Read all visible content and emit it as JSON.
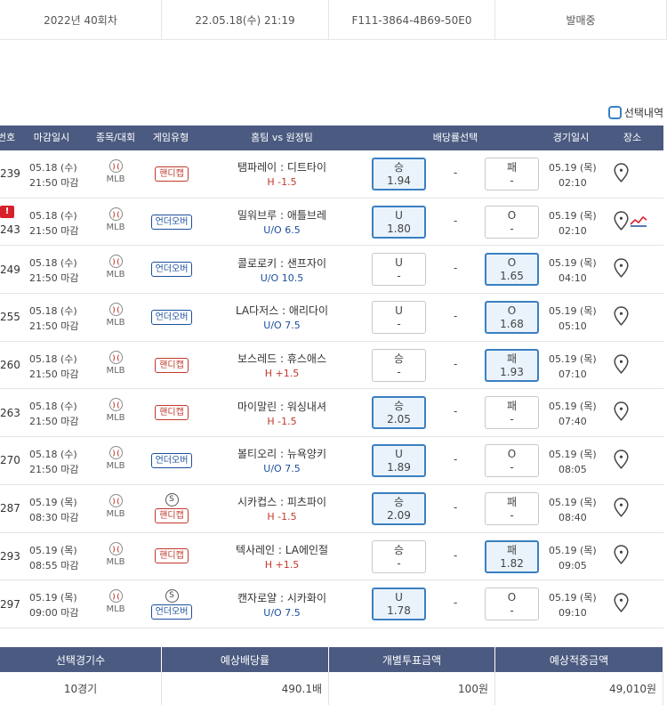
{
  "top": {
    "round": "2022년 40회차",
    "datetime": "22.05.18(수) 21:19",
    "code": "F111-3864-4B69-50E0",
    "status": "발매중"
  },
  "legend": {
    "label": "선택내역"
  },
  "headers": [
    "번호",
    "마감일시",
    "종목/대회",
    "게임유형",
    "홈팀 vs 원정팀",
    "배당률선택",
    "경기일시",
    "장소"
  ],
  "games": [
    {
      "no": "239",
      "alert": "",
      "close_date": "05.18 (수)",
      "close_time": "21:50 마감",
      "league": "MLB",
      "special": "",
      "type": "핸디캡",
      "type_kind": "handi",
      "match": "탬파레이 : 디트타이",
      "line": "H -1.5",
      "line_color": "red",
      "left_label": "승",
      "left_odds": "1.94",
      "left_selected": true,
      "mid": "-",
      "right_label": "패",
      "right_odds": "-",
      "right_selected": false,
      "game_date": "05.19 (목)",
      "game_time": "02:10",
      "trend": false
    },
    {
      "no": "243",
      "alert": "!",
      "close_date": "05.18 (수)",
      "close_time": "21:50 마감",
      "league": "MLB",
      "special": "",
      "type": "언더오버",
      "type_kind": "ou",
      "match": "밀워브루 : 애틀브레",
      "line": "U/O 6.5",
      "line_color": "blue",
      "left_label": "U",
      "left_odds": "1.80",
      "left_selected": true,
      "mid": "-",
      "right_label": "O",
      "right_odds": "-",
      "right_selected": false,
      "game_date": "05.19 (목)",
      "game_time": "02:10",
      "trend": true
    },
    {
      "no": "249",
      "alert": "",
      "close_date": "05.18 (수)",
      "close_time": "21:50 마감",
      "league": "MLB",
      "special": "",
      "type": "언더오버",
      "type_kind": "ou",
      "match": "콜로로키 : 샌프자이",
      "line": "U/O 10.5",
      "line_color": "blue",
      "left_label": "U",
      "left_odds": "-",
      "left_selected": false,
      "mid": "-",
      "right_label": "O",
      "right_odds": "1.65",
      "right_selected": true,
      "game_date": "05.19 (목)",
      "game_time": "04:10",
      "trend": false
    },
    {
      "no": "255",
      "alert": "",
      "close_date": "05.18 (수)",
      "close_time": "21:50 마감",
      "league": "MLB",
      "special": "",
      "type": "언더오버",
      "type_kind": "ou",
      "match": "LA다저스 : 애리다이",
      "line": "U/O 7.5",
      "line_color": "blue",
      "left_label": "U",
      "left_odds": "-",
      "left_selected": false,
      "mid": "-",
      "right_label": "O",
      "right_odds": "1.68",
      "right_selected": true,
      "game_date": "05.19 (목)",
      "game_time": "05:10",
      "trend": false
    },
    {
      "no": "260",
      "alert": "",
      "close_date": "05.18 (수)",
      "close_time": "21:50 마감",
      "league": "MLB",
      "special": "",
      "type": "핸디캡",
      "type_kind": "handi",
      "match": "보스레드 : 휴스애스",
      "line": "H +1.5",
      "line_color": "red",
      "left_label": "승",
      "left_odds": "-",
      "left_selected": false,
      "mid": "-",
      "right_label": "패",
      "right_odds": "1.93",
      "right_selected": true,
      "game_date": "05.19 (목)",
      "game_time": "07:10",
      "trend": false
    },
    {
      "no": "263",
      "alert": "",
      "close_date": "05.18 (수)",
      "close_time": "21:50 마감",
      "league": "MLB",
      "special": "",
      "type": "핸디캡",
      "type_kind": "handi",
      "match": "마이말린 : 워싱내셔",
      "line": "H -1.5",
      "line_color": "red",
      "left_label": "승",
      "left_odds": "2.05",
      "left_selected": true,
      "mid": "-",
      "right_label": "패",
      "right_odds": "-",
      "right_selected": false,
      "game_date": "05.19 (목)",
      "game_time": "07:40",
      "trend": false
    },
    {
      "no": "270",
      "alert": "",
      "close_date": "05.18 (수)",
      "close_time": "21:50 마감",
      "league": "MLB",
      "special": "",
      "type": "언더오버",
      "type_kind": "ou",
      "match": "볼티오리 : 뉴욕양키",
      "line": "U/O 7.5",
      "line_color": "blue",
      "left_label": "U",
      "left_odds": "1.89",
      "left_selected": true,
      "mid": "-",
      "right_label": "O",
      "right_odds": "-",
      "right_selected": false,
      "game_date": "05.19 (목)",
      "game_time": "08:05",
      "trend": false
    },
    {
      "no": "287",
      "alert": "",
      "close_date": "05.19 (목)",
      "close_time": "08:30 마감",
      "league": "MLB",
      "special": "S",
      "type": "핸디캡",
      "type_kind": "handi",
      "match": "시카컵스 : 피츠파이",
      "line": "H -1.5",
      "line_color": "red",
      "left_label": "승",
      "left_odds": "2.09",
      "left_selected": true,
      "mid": "-",
      "right_label": "패",
      "right_odds": "-",
      "right_selected": false,
      "game_date": "05.19 (목)",
      "game_time": "08:40",
      "trend": false
    },
    {
      "no": "293",
      "alert": "",
      "close_date": "05.19 (목)",
      "close_time": "08:55 마감",
      "league": "MLB",
      "special": "",
      "type": "핸디캡",
      "type_kind": "handi",
      "match": "텍사레인 : LA에인절",
      "line": "H +1.5",
      "line_color": "red",
      "left_label": "승",
      "left_odds": "-",
      "left_selected": false,
      "mid": "-",
      "right_label": "패",
      "right_odds": "1.82",
      "right_selected": true,
      "game_date": "05.19 (목)",
      "game_time": "09:05",
      "trend": false
    },
    {
      "no": "297",
      "alert": "",
      "close_date": "05.19 (목)",
      "close_time": "09:00 마감",
      "league": "MLB",
      "special": "S",
      "type": "언더오버",
      "type_kind": "ou",
      "match": "캔자로얄 : 시카화이",
      "line": "U/O 7.5",
      "line_color": "blue",
      "left_label": "U",
      "left_odds": "1.78",
      "left_selected": true,
      "mid": "-",
      "right_label": "O",
      "right_odds": "-",
      "right_selected": false,
      "game_date": "05.19 (목)",
      "game_time": "09:10",
      "trend": false
    }
  ],
  "summary": {
    "headers": [
      "선택경기수",
      "예상배당률",
      "개별투표금액",
      "예상적중금액"
    ],
    "values": [
      "10경기",
      "490.1배",
      "100원",
      "49,010원"
    ]
  }
}
